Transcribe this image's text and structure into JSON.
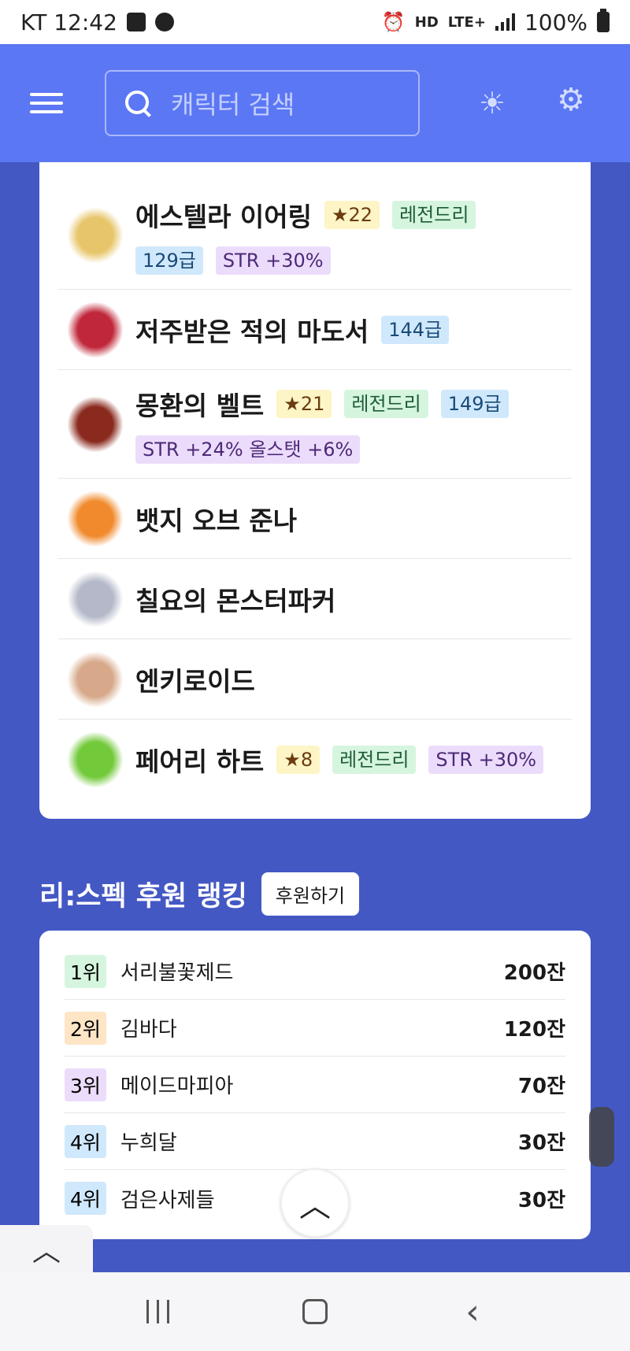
{
  "status_bar": {
    "carrier_time": "KT 12:42",
    "network": "LTE+",
    "hd": "HD",
    "battery": "100%"
  },
  "header": {
    "search_placeholder": "캐릭터 검색"
  },
  "equipment": [
    {
      "name": "에스텔라 이어링",
      "star": "★22",
      "rarity": "레전드리",
      "level": "129급",
      "stat": "STR +30%",
      "icon": "earring-icon",
      "icon_color": "#e7c56a"
    },
    {
      "name": "저주받은 적의 마도서",
      "level": "144급",
      "icon": "book-icon",
      "icon_color": "#c0273a"
    },
    {
      "name": "몽환의 벨트",
      "star": "★21",
      "rarity": "레전드리",
      "level": "149급",
      "stat": "STR +24% 올스탯 +6%",
      "icon": "belt-icon",
      "icon_color": "#8a2a1e"
    },
    {
      "name": "뱃지 오브 준나",
      "icon": "badge-icon",
      "icon_color": "#f08a2c"
    },
    {
      "name": "칠요의 몬스터파커",
      "icon": "medal-icon",
      "icon_color": "#b4b8c8"
    },
    {
      "name": "엔키로이드",
      "icon": "egg-icon",
      "icon_color": "#d7a98a"
    },
    {
      "name": "페어리 하트",
      "star": "★8",
      "rarity": "레전드리",
      "stat": "STR +30%",
      "icon": "heart-icon",
      "icon_color": "#72c93a"
    }
  ],
  "ranking": {
    "title": "리:스펙 후원 랭킹",
    "sponsor_button": "후원하기",
    "rows": [
      {
        "rank": "1위",
        "name": "서리불꽃제드",
        "amount": "200잔",
        "color": "#d6f5df"
      },
      {
        "rank": "2위",
        "name": "김바다",
        "amount": "120잔",
        "color": "#fde5c6"
      },
      {
        "rank": "3위",
        "name": "메이드마피아",
        "amount": "70잔",
        "color": "#ecdcfb"
      },
      {
        "rank": "4위",
        "name": "누희달",
        "amount": "30잔",
        "color": "#d0e8fb"
      },
      {
        "rank": "4위",
        "name": "검은사제들",
        "amount": "30잔",
        "color": "#d0e8fb"
      }
    ]
  },
  "colors": {
    "header": "#5b77f4",
    "background": "#4458c4"
  }
}
